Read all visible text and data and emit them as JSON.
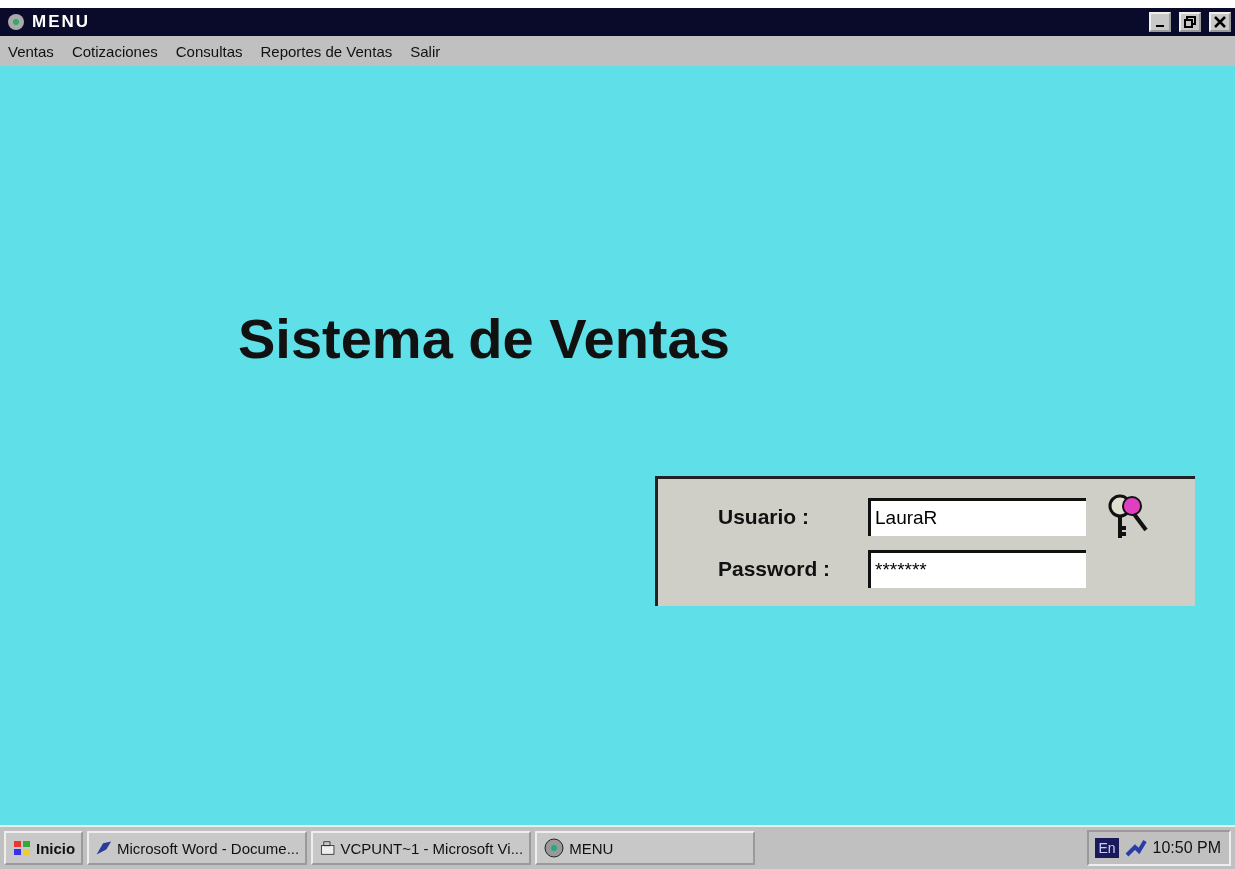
{
  "window": {
    "title": "MENU"
  },
  "menu": [
    "Ventas",
    "Cotizaciones",
    "Consultas",
    "Reportes de Ventas",
    "Salir"
  ],
  "heading": "Sistema de Ventas",
  "login": {
    "fields": [
      {
        "label": "Usuario :",
        "value": "LauraR"
      },
      {
        "label": "Password :",
        "value": "*******"
      }
    ]
  },
  "taskbar": {
    "start": "Inicio",
    "tasks": [
      {
        "label": "Microsoft Word - Docume...",
        "kind": "word"
      },
      {
        "label": "VCPUNT~1 - Microsoft Vi...",
        "kind": "project"
      },
      {
        "label": "MENU",
        "kind": "app"
      }
    ],
    "language": "En",
    "clock": "10:50 PM"
  }
}
